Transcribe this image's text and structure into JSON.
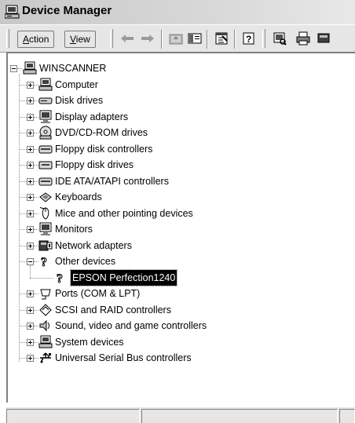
{
  "window": {
    "title": "Device Manager"
  },
  "toolbar": {
    "menus": [
      {
        "label_prefix": "",
        "label_underlined": "A",
        "label_rest": "ction"
      },
      {
        "label_prefix": "",
        "label_underlined": "V",
        "label_rest": "iew"
      }
    ],
    "buttons": [
      "back-arrow-icon",
      "forward-arrow-icon",
      "up-folder-icon",
      "show-hide-tree-icon",
      "properties-icon",
      "help-icon",
      "scan-hardware-icon",
      "print-icon"
    ]
  },
  "tree": {
    "root": "WINSCANNER",
    "categories": [
      {
        "label": "Computer",
        "icon": "computer-icon",
        "expanded": false
      },
      {
        "label": "Disk drives",
        "icon": "disk-drive-icon",
        "expanded": false
      },
      {
        "label": "Display adapters",
        "icon": "display-adapter-icon",
        "expanded": false
      },
      {
        "label": "DVD/CD-ROM drives",
        "icon": "cdrom-icon",
        "expanded": false
      },
      {
        "label": "Floppy disk controllers",
        "icon": "floppy-controller-icon",
        "expanded": false
      },
      {
        "label": "Floppy disk drives",
        "icon": "floppy-drive-icon",
        "expanded": false
      },
      {
        "label": "IDE ATA/ATAPI controllers",
        "icon": "ide-controller-icon",
        "expanded": false
      },
      {
        "label": "Keyboards",
        "icon": "keyboard-icon",
        "expanded": false
      },
      {
        "label": "Mice and other pointing devices",
        "icon": "mouse-icon",
        "expanded": false
      },
      {
        "label": "Monitors",
        "icon": "monitor-icon",
        "expanded": false
      },
      {
        "label": "Network adapters",
        "icon": "network-adapter-icon",
        "expanded": false
      },
      {
        "label": "Other devices",
        "icon": "unknown-device-icon",
        "expanded": true,
        "children": [
          {
            "label": "EPSON Perfection1240",
            "icon": "unknown-device-icon",
            "selected": true
          }
        ]
      },
      {
        "label": "Ports (COM & LPT)",
        "icon": "port-icon",
        "expanded": false
      },
      {
        "label": "SCSI and RAID controllers",
        "icon": "scsi-controller-icon",
        "expanded": false
      },
      {
        "label": "Sound, video and game controllers",
        "icon": "sound-icon",
        "expanded": false
      },
      {
        "label": "System devices",
        "icon": "system-device-icon",
        "expanded": false
      },
      {
        "label": "Universal Serial Bus controllers",
        "icon": "usb-icon",
        "expanded": false
      }
    ]
  }
}
